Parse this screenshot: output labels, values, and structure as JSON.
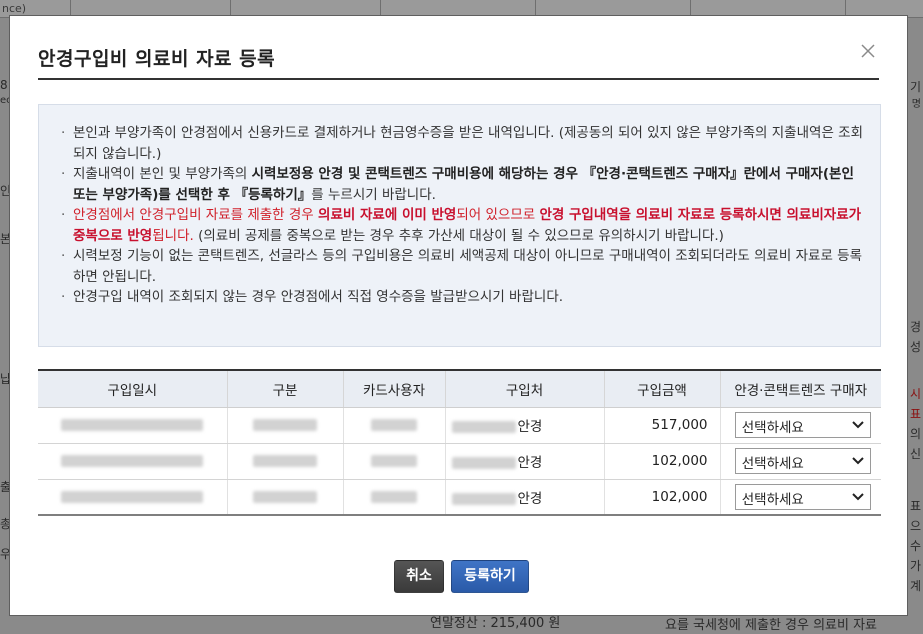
{
  "background": {
    "top_fragment": "nce)",
    "left_fragments": [
      "8",
      "ec",
      "인",
      "본",
      "납",
      "출",
      "총",
      "우"
    ],
    "right_fragments": [
      "기",
      "명",
      "경",
      "성",
      "시",
      "표",
      "의",
      "신",
      "표",
      "으",
      "수",
      "가",
      "계"
    ],
    "bottom_text_1": "연말정산 : 215,400 원",
    "bottom_text_2": "요를 국세청에 제출한 경우 의료비 자료"
  },
  "modal": {
    "title": "안경구입비 의료비 자료 등록",
    "close_label": "닫기",
    "notice": {
      "item1": "본인과 부양가족이 안경점에서 신용카드로 결제하거나 현금영수증을 받은 내역입니다. (제공동의 되어 있지 않은 부양가족의 지출내역은 조회되지 않습니다.)",
      "item2_a": "지출내역이 본인 및 부양가족의 ",
      "item2_b": "시력보정용 안경 및 콘택트렌즈 구매비용에 해당하는 경우 『안경·콘택트렌즈 구매자』란에서 구매자(본인 또는 부양가족)를 선택한 후 『등록하기』",
      "item2_c": "를 누르시기 바랍니다.",
      "item3_a": "안경점에서 안경구입비 자료를 제출한 경우 ",
      "item3_b": "의료비 자료에 이미 반영",
      "item3_c": "되어 있으므로 ",
      "item3_d": "안경 구입내역을 의료비 자료로 등록하시면 의료비자료가 중복으로 반영",
      "item3_e": "됩니다.",
      "item3_f": " (의료비 공제를 중복으로 받는 경우 추후 가산세 대상이 될 수 있으므로 유의하시기 바랍니다.)",
      "item4": "시력보정 기능이 없는 콘택트렌즈, 선글라스 등의 구입비용은 의료비 세액공제 대상이 아니므로 구매내역이 조회되더라도 의료비 자료로 등록하면 안됩니다.",
      "item5": "안경구입 내역이 조회되지 않는 경우 안경점에서 직접 영수증을 발급받으시기 바랍니다."
    },
    "table": {
      "headers": [
        "구입일시",
        "구분",
        "카드사용자",
        "구입처",
        "구입금액",
        "안경·콘택트렌즈 구매자"
      ],
      "rows": [
        {
          "vendor_suffix": "안경",
          "amount": "517,000",
          "buyer": "선택하세요"
        },
        {
          "vendor_suffix": "안경",
          "amount": "102,000",
          "buyer": "선택하세요"
        },
        {
          "vendor_suffix": "안경",
          "amount": "102,000",
          "buyer": "선택하세요"
        }
      ]
    },
    "buttons": {
      "cancel": "취소",
      "submit": "등록하기"
    }
  },
  "colors": {
    "accent_blue": "#2f63b5",
    "warning_red": "#d0202a",
    "notice_bg": "#eef2f8",
    "header_bg": "#e9edf3"
  },
  "icons": {
    "close": "close-icon",
    "select_arrow": "chevron-down-icon"
  }
}
